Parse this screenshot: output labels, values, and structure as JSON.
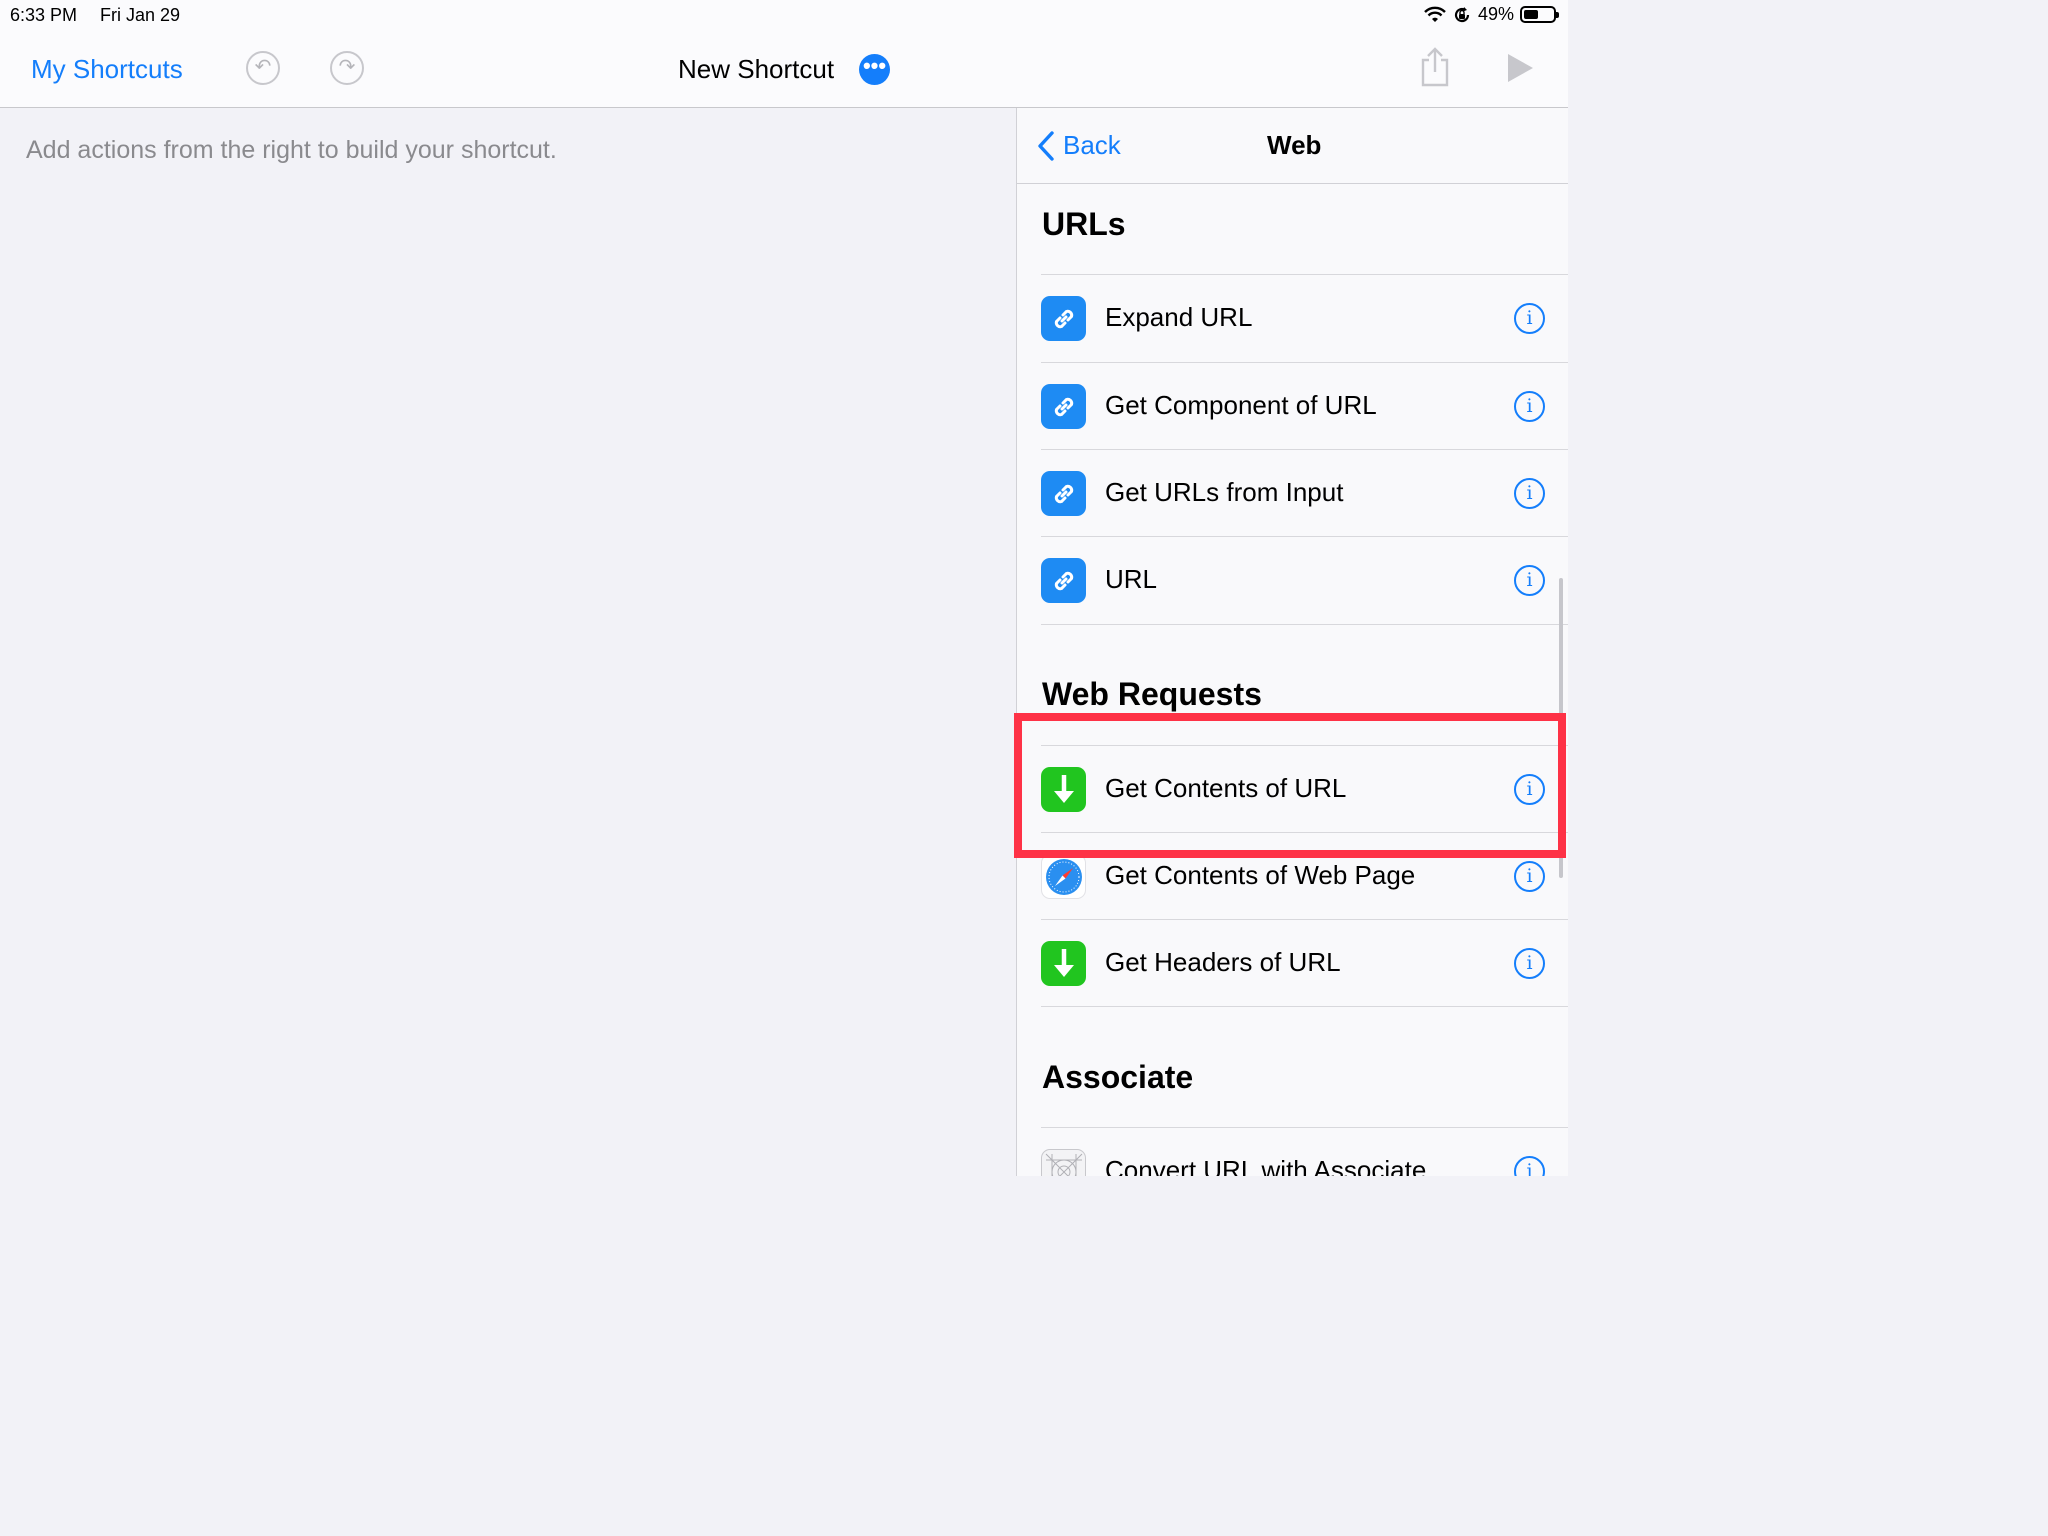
{
  "status_bar": {
    "time": "6:33 PM",
    "date": "Fri Jan 29",
    "battery": "49%",
    "battery_level": 0.49,
    "icons": [
      "wifi-icon",
      "orientation-lock-icon",
      "battery-icon"
    ]
  },
  "toolbar": {
    "back_label": "My Shortcuts",
    "title": "New Shortcut",
    "more_symbol": "•••",
    "undo_symbol": "↶",
    "redo_symbol": "↷"
  },
  "editor": {
    "hint": "Add actions from the right to build your shortcut."
  },
  "panel": {
    "nav": {
      "back_label": "Back",
      "title": "Web"
    },
    "sections": [
      {
        "title": "URLs",
        "items": [
          {
            "label": "Expand URL",
            "icon": "link-icon"
          },
          {
            "label": "Get Component of URL",
            "icon": "link-icon"
          },
          {
            "label": "Get URLs from Input",
            "icon": "link-icon"
          },
          {
            "label": "URL",
            "icon": "link-icon"
          }
        ]
      },
      {
        "title": "Web Requests",
        "items": [
          {
            "label": "Get Contents of URL",
            "icon": "download-arrow-icon"
          },
          {
            "label": "Get Contents of Web Page",
            "icon": "safari-compass-icon"
          },
          {
            "label": "Get Headers of URL",
            "icon": "download-arrow-icon"
          }
        ]
      },
      {
        "title": "Associate",
        "items": [
          {
            "label": "Convert URL with Associate",
            "icon": "app-grid-icon"
          }
        ]
      }
    ],
    "info_symbol": "i"
  },
  "colors": {
    "accent": "#147efb",
    "highlight": "#fe3246",
    "link_icon_bg": "#1e8bf3",
    "download_icon_bg": "#21c51f"
  }
}
